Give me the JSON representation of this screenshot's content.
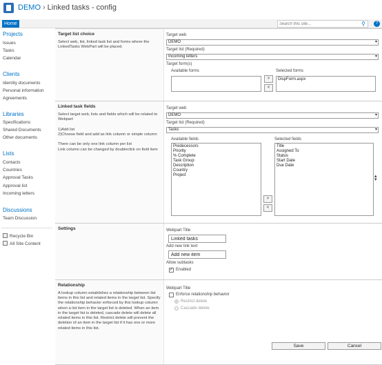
{
  "header": {
    "site": "DEMO",
    "separator": "›",
    "page": "Linked tasks - config",
    "home_tab": "Home",
    "search_placeholder": "Search this site...",
    "help": "?"
  },
  "leftnav": {
    "projects": {
      "title": "Projects",
      "items": [
        "Issues",
        "Tasks",
        "Calendar"
      ]
    },
    "clients": {
      "title": "Clients",
      "items": [
        "Identity documents",
        "Personal information",
        "Agreements"
      ]
    },
    "libraries": {
      "title": "Libraries",
      "items": [
        "Specifications",
        "Shared Documents",
        "Other documents"
      ]
    },
    "lists": {
      "title": "Lists",
      "items": [
        "Contacts",
        "Countries",
        "Approval Tasks",
        "Approval list",
        "Incoming letters"
      ]
    },
    "discussions": {
      "title": "Discussions",
      "items": [
        "Team Discussion"
      ]
    },
    "utility": [
      "Recycle Bin",
      "All Site Content"
    ]
  },
  "target_list_choice": {
    "title": "Target list choice",
    "description": "Select web, list, linked task list and forms where the LinkedTasks WebPart will be placed.",
    "web_label": "Target web",
    "web_value": "DEMO",
    "list_label": "Target list (Required)",
    "list_value": "Incoming letters",
    "forms_label": "Target form(s)",
    "available_label": "Available forms",
    "selected_label": "Selected forms",
    "available": [],
    "selected": [
      "DispForm.aspx"
    ],
    "add_btn": ">",
    "remove_btn": "<"
  },
  "linked_task_fields": {
    "title": "Linked task fields",
    "description": "Select target web, lists and fields which will be related to Webpart\n\n1)Add list\n2)Choose field and add as link column or simple column\n\nThere can be only one link column per list\nLink column can be changed by doubleclick on field item",
    "web_label": "Target web",
    "web_value": "DEMO",
    "list_label": "Target list (Required)",
    "list_value": "Tasks",
    "available_label": "Available fields",
    "selected_label": "Selected fields",
    "available": [
      "Predecessors",
      "Priority",
      "% Complete",
      "Task Group",
      "Description",
      "Country",
      "Project"
    ],
    "selected": [
      "Title",
      "Assigned To",
      "Status",
      "Start Date",
      "Due Date"
    ],
    "add_btn": ">",
    "remove_btn": "<"
  },
  "settings": {
    "title": "Settings",
    "webpart_title_label": "Webpart Title",
    "webpart_title_value": "Linked tasks",
    "add_link_label": "Add new link text",
    "add_link_value": "Add new item",
    "subtasks_label": "Allow subtasks",
    "enabled_label": "Enabled",
    "enabled_checked": true
  },
  "relationship": {
    "title": "Relationship",
    "description": "A lookup column establishes a relationship between list items in this list and related items in the target list. Specify the relationship behavior enforced by this lookup column when a list item in the target list is deleted. When an item in the target list is deleted, cascade delete will delete all related items in this list. Restrict delete will prevent the deletion of an item in the target list if it has one or more related items in this list.",
    "webpart_title_label": "Webpart Title",
    "enforce_label": "Enforce relationship behavior",
    "restrict_label": "Restrict delete",
    "cascade_label": "Cascade delete"
  },
  "footer": {
    "save": "Save",
    "cancel": "Cancel"
  }
}
